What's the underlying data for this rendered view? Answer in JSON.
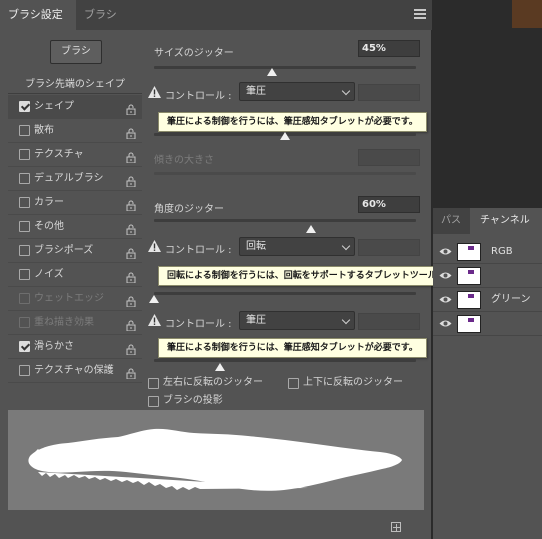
{
  "tabs": {
    "brush_settings": "ブラシ設定",
    "brush": "ブラシ"
  },
  "brush_button": "ブラシ",
  "tip_shape_header": "ブラシ先端のシェイプ",
  "options": [
    {
      "label": "シェイプ",
      "checked": true,
      "enabled": true,
      "selected": true
    },
    {
      "label": "散布",
      "checked": false,
      "enabled": true
    },
    {
      "label": "テクスチャ",
      "checked": false,
      "enabled": true
    },
    {
      "label": "デュアルブラシ",
      "checked": false,
      "enabled": true
    },
    {
      "label": "カラー",
      "checked": false,
      "enabled": true
    },
    {
      "label": "その他",
      "checked": false,
      "enabled": true
    },
    {
      "label": "ブラシポーズ",
      "checked": false,
      "enabled": true
    },
    {
      "label": "ノイズ",
      "checked": false,
      "enabled": true
    },
    {
      "label": "ウェットエッジ",
      "checked": false,
      "enabled": false
    },
    {
      "label": "重ね描き効果",
      "checked": false,
      "enabled": false
    },
    {
      "label": "滑らかさ",
      "checked": true,
      "enabled": true
    },
    {
      "label": "テクスチャの保護",
      "checked": false,
      "enabled": true
    }
  ],
  "size_jitter": {
    "label": "サイズのジッター",
    "value": "45%",
    "level": 0.45
  },
  "size_control": {
    "label": "コントロール :",
    "value": "筆圧",
    "warning": "筆圧による制御を行うには、筆圧感知タブレットが必要です。"
  },
  "min_diameter": {
    "level": 0.5
  },
  "tilt_scale": {
    "label": "傾きの大きさ"
  },
  "angle_jitter": {
    "label": "角度のジッター",
    "value": "60%",
    "level": 0.6
  },
  "angle_control": {
    "label": "コントロール :",
    "value": "回転",
    "warning": "回転による制御を行うには、回転をサポートするタブレットツールが必要です。"
  },
  "roundness_jitter": {
    "level": 0.0
  },
  "roundness_control": {
    "label": "コントロール :",
    "value": "筆圧",
    "warning": "筆圧による制御を行うには、筆圧感知タブレットが必要です。"
  },
  "min_roundness": {
    "level": 0.25
  },
  "flip_x": "左右に反転のジッター",
  "flip_y": "上下に反転のジッター",
  "brush_projection": "ブラシの投影",
  "channels_panel": {
    "tabs": {
      "paths": "パス",
      "channels": "チャンネル"
    },
    "rows": [
      {
        "name": "RGB"
      },
      {
        "name": ""
      },
      {
        "name": "グリーン"
      },
      {
        "name": ""
      }
    ]
  },
  "colors": {
    "panel": "#535353",
    "tooltip_bg": "#ffffe1"
  }
}
